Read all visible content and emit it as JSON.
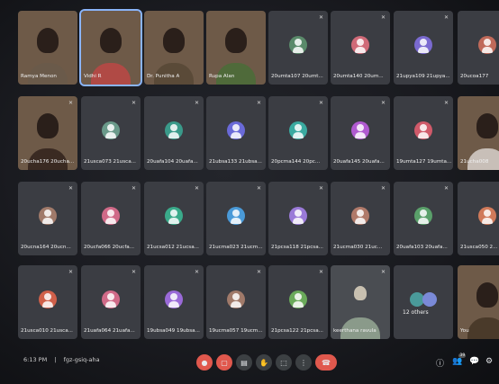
{
  "meeting": {
    "time": "6:13 PM",
    "separator": "|",
    "code": "fgz-gsiq-aha"
  },
  "tiles": [
    {
      "name": "Ramya Menon",
      "type": "camera",
      "mic": "",
      "color": "#6a5a4a"
    },
    {
      "name": "Vidhi R",
      "type": "camera",
      "mic": "",
      "color": "#b04a45"
    },
    {
      "name": "Dr. Punitha A",
      "type": "camera",
      "mic": "",
      "color": "#5a4a38"
    },
    {
      "name": "Rupa Alan",
      "type": "camera",
      "mic": "",
      "color": "#4f6a3a"
    },
    {
      "name": "20umta107 20umt...",
      "type": "avatar",
      "mic": "✕",
      "color": "#5a8a6a"
    },
    {
      "name": "20umta140 20um...",
      "type": "avatar",
      "mic": "✕",
      "color": "#d06a78"
    },
    {
      "name": "21upya109 21upya...",
      "type": "avatar",
      "mic": "✕",
      "color": "#7a6ad0"
    },
    {
      "name": "20ucoa177",
      "type": "avatar",
      "mic": "",
      "color": "#c06a5a"
    },
    {
      "name": "20ucha176 20ucha...",
      "type": "camera",
      "mic": "✕",
      "color": "#3a2a22"
    },
    {
      "name": "21usca073 21usca...",
      "type": "avatar",
      "mic": "✕",
      "color": "#6a9a8a"
    },
    {
      "name": "20uafa104 20uafa...",
      "type": "avatar",
      "mic": "✕",
      "color": "#3a9a8a"
    },
    {
      "name": "21ubsa133 21ubsa...",
      "type": "avatar",
      "mic": "✕",
      "color": "#6a6ad8"
    },
    {
      "name": "20pcma144 20pc...",
      "type": "avatar",
      "mic": "✕",
      "color": "#3aaaa0"
    },
    {
      "name": "20uafa145 20uafa...",
      "type": "avatar",
      "mic": "✕",
      "color": "#b05ad0"
    },
    {
      "name": "19umta127 19umta...",
      "type": "avatar",
      "mic": "✕",
      "color": "#d05a6a"
    },
    {
      "name": "21ucha008",
      "type": "camera",
      "mic": "",
      "color": "#c8bfb8"
    },
    {
      "name": "20ucna164 20ucn...",
      "type": "avatar",
      "mic": "✕",
      "color": "#a07a6a"
    },
    {
      "name": "20ucfa066 20ucfa...",
      "type": "avatar",
      "mic": "✕",
      "color": "#d06a88"
    },
    {
      "name": "21ucsa012 21ucsa...",
      "type": "avatar",
      "mic": "✕",
      "color": "#3aaa8a"
    },
    {
      "name": "21ucma023 21ucm...",
      "type": "avatar",
      "mic": "✕",
      "color": "#4a9ad8"
    },
    {
      "name": "21pcsa118 21pcsa...",
      "type": "avatar",
      "mic": "✕",
      "color": "#9a7ad8"
    },
    {
      "name": "21ucma030 21uc...",
      "type": "avatar",
      "mic": "✕",
      "color": "#b07a6a"
    },
    {
      "name": "20uafa103 20uafa...",
      "type": "avatar",
      "mic": "✕",
      "color": "#5aa06a"
    },
    {
      "name": "21usca050 2...",
      "type": "avatar",
      "mic": "",
      "color": "#d07a5a"
    },
    {
      "name": "21usca010 21usca...",
      "type": "avatar",
      "mic": "✕",
      "color": "#d0604a"
    },
    {
      "name": "21uafa064 21uafa...",
      "type": "avatar",
      "mic": "✕",
      "color": "#d06a88"
    },
    {
      "name": "19ubsa049 19ubsa...",
      "type": "avatar",
      "mic": "✕",
      "color": "#9a6ad8"
    },
    {
      "name": "19ucma057 19ucm...",
      "type": "avatar",
      "mic": "✕",
      "color": "#a07a6a"
    },
    {
      "name": "21pcsa122 21pcsa...",
      "type": "avatar",
      "mic": "✕",
      "color": "#6aaa5a"
    },
    {
      "name": "keerthana ravula",
      "type": "photo",
      "mic": "✕",
      "color": "#8a9a8a"
    },
    {
      "name": "12 others",
      "type": "others",
      "mic": "",
      "color": "#4a9a9a"
    },
    {
      "name": "You",
      "type": "camera",
      "mic": "",
      "color": "#4a3a2a"
    }
  ],
  "controls": [
    {
      "name": "mic-toggle",
      "icon": "🎤",
      "color": "#e0584d"
    },
    {
      "name": "camera-toggle",
      "icon": "▢",
      "color": "#e0584d"
    },
    {
      "name": "captions-toggle",
      "icon": "▤",
      "color": "#3c4043"
    },
    {
      "name": "raise-hand",
      "icon": "✋",
      "color": "#3c4043"
    },
    {
      "name": "present-screen",
      "icon": "⬚",
      "color": "#3c4043"
    },
    {
      "name": "more-options",
      "icon": "⋮",
      "color": "#3c4043"
    },
    {
      "name": "end-call",
      "icon": "☎",
      "color": "#e0584d"
    }
  ],
  "right_panel": {
    "people_badge": "39"
  }
}
